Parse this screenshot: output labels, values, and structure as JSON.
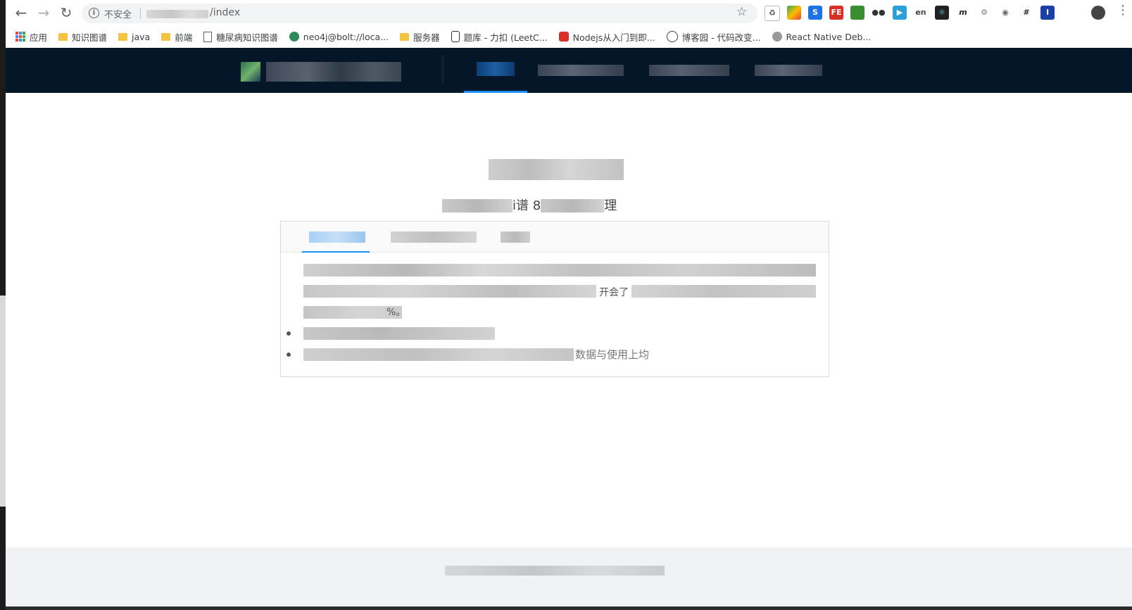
{
  "browser": {
    "security_label": "不安全",
    "url_path": "/index",
    "bookmarks": [
      {
        "label": "应用",
        "icon": "apps-icon"
      },
      {
        "label": "知识图谱",
        "icon": "folder-icon"
      },
      {
        "label": "java",
        "icon": "folder-icon"
      },
      {
        "label": "前端",
        "icon": "folder-icon"
      },
      {
        "label": "糖尿病知识图谱",
        "icon": "page-icon"
      },
      {
        "label": "neo4j@bolt://loca...",
        "icon": "neo4j-icon"
      },
      {
        "label": "服务器",
        "icon": "folder-icon"
      },
      {
        "label": "题库 - 力扣 (LeetC...",
        "icon": "leetcode-icon"
      },
      {
        "label": "Nodejs从入门到即...",
        "icon": "nodejs-icon"
      },
      {
        "label": "博客园 - 代码改变...",
        "icon": "cnblogs-icon"
      },
      {
        "label": "React Native Deb...",
        "icon": "react-native-icon"
      }
    ]
  },
  "card": {
    "line_2_fragment": "开会了",
    "line_3_fragment": "%。",
    "bullet_2_fragment": "数据与使用上均"
  },
  "hero": {
    "subtitle_fragment_1": "i谱 8",
    "subtitle_fragment_2": "理"
  },
  "colors": {
    "header_bg": "#051629",
    "accent": "#1890ff",
    "footer_bg": "#f0f2f5"
  }
}
